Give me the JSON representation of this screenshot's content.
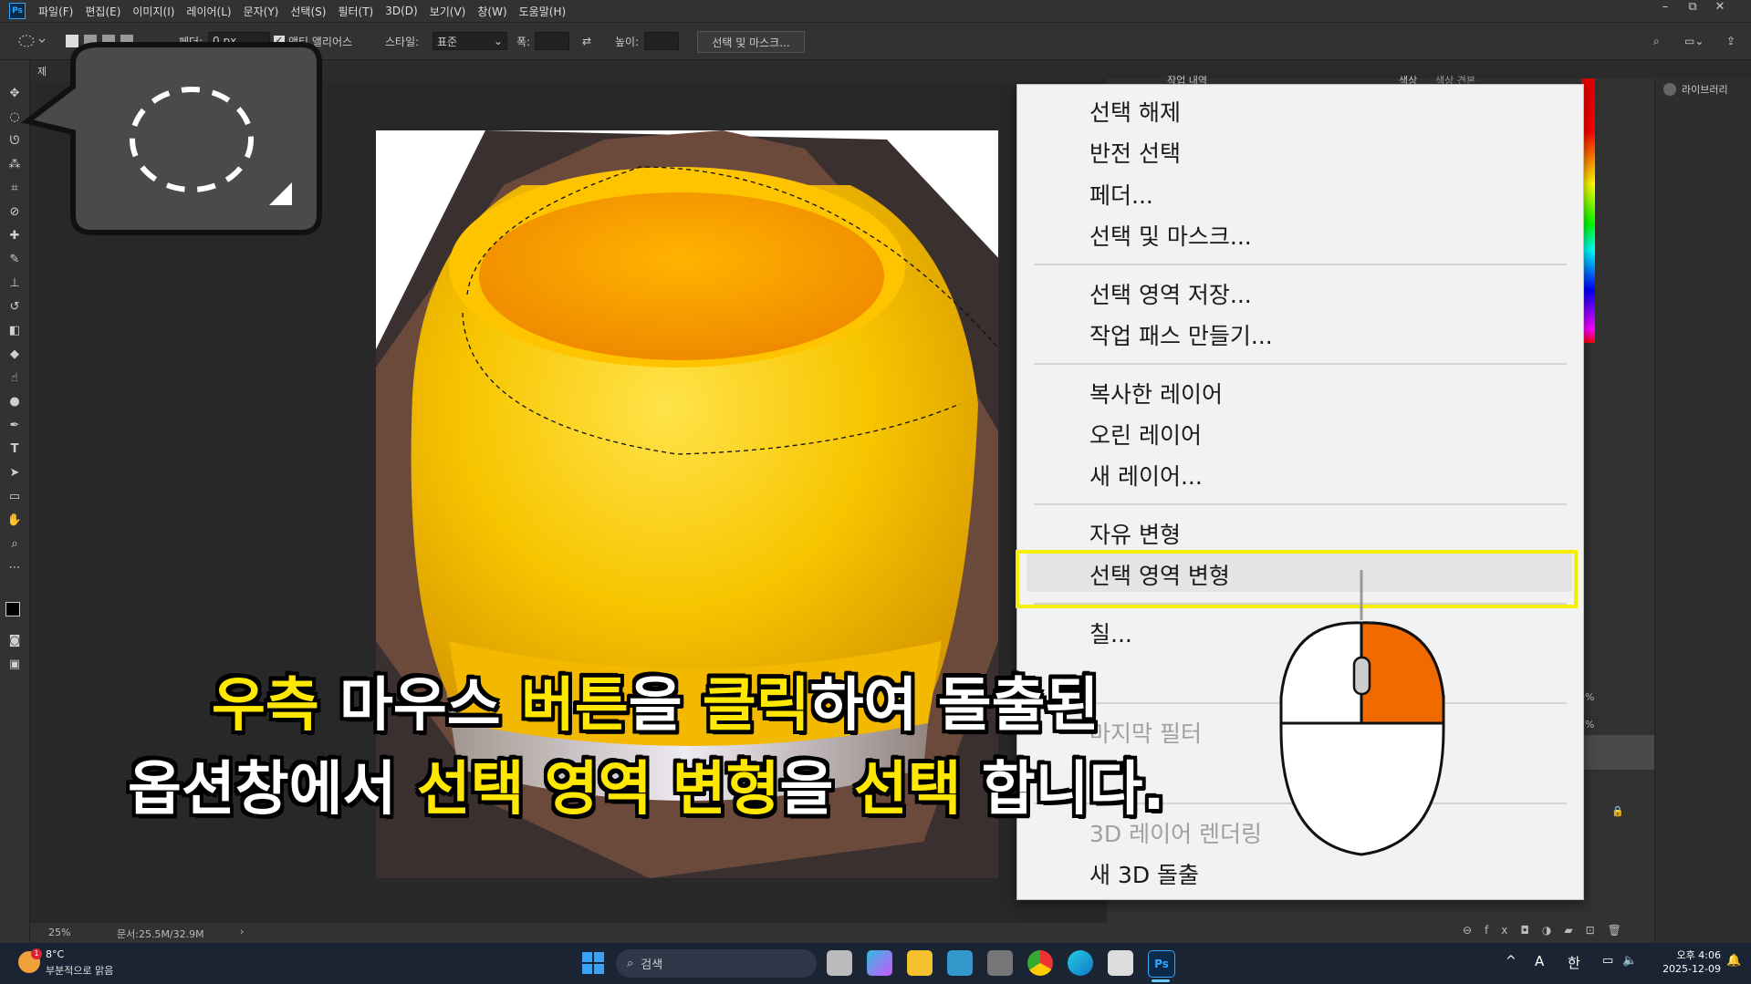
{
  "app": {
    "logo": "Ps"
  },
  "menubar": {
    "items": [
      "파일(F)",
      "편집(E)",
      "이미지(I)",
      "레이어(L)",
      "문자(Y)",
      "선택(S)",
      "필터(T)",
      "3D(D)",
      "보기(V)",
      "창(W)",
      "도움말(H)"
    ],
    "window_controls": [
      "–",
      "⧉",
      "✕"
    ]
  },
  "options": {
    "feather_label": "페더:",
    "feather_value": "0 px",
    "antialias_label": "앤티 앨리어스",
    "antialias_checked": true,
    "style_label": "스타일:",
    "style_value": "표준",
    "width_label": "폭:",
    "height_label": "높이:",
    "select_mask_button": "선택 및 마스크..."
  },
  "document": {
    "tab_label": "제"
  },
  "statusbar": {
    "zoom": "25%",
    "doc_info": "문서:25.5M/32.9M",
    "arrow": "›"
  },
  "panels": {
    "history_tab": "작업 내역",
    "color_tab": "색상",
    "swatches_tab": "색상 견본",
    "libraries": "라이브러리",
    "opacity_1": "%",
    "opacity_2": "%"
  },
  "context_menu": {
    "groups": [
      {
        "items": [
          {
            "label": "선택 해제",
            "disabled": false
          },
          {
            "label": "반전 선택",
            "disabled": false
          },
          {
            "label": "페더...",
            "disabled": false
          },
          {
            "label": "선택 및 마스크...",
            "disabled": false
          }
        ]
      },
      {
        "items": [
          {
            "label": "선택 영역 저장...",
            "disabled": false
          },
          {
            "label": "작업 패스 만들기...",
            "disabled": false
          }
        ]
      },
      {
        "items": [
          {
            "label": "복사한 레이어",
            "disabled": false
          },
          {
            "label": "오린 레이어",
            "disabled": false
          },
          {
            "label": "새 레이어...",
            "disabled": false
          }
        ]
      },
      {
        "items": [
          {
            "label": "자유 변형",
            "disabled": false
          },
          {
            "label": "선택 영역 변형",
            "disabled": false,
            "highlighted": true
          }
        ]
      },
      {
        "items": [
          {
            "label": "칠...",
            "disabled": false
          }
        ]
      },
      {
        "items": [
          {
            "label": "마지막 필터",
            "disabled": true
          }
        ]
      },
      {
        "items": [
          {
            "label": "3D 레이어 렌더링",
            "disabled": true
          },
          {
            "label": "새 3D 돌출",
            "disabled": false
          }
        ]
      }
    ]
  },
  "subtitle": {
    "line1": [
      {
        "text": "우측",
        "highlight": true
      },
      {
        "text": " 마우스 ",
        "highlight": false
      },
      {
        "text": "버튼",
        "highlight": true
      },
      {
        "text": "을 ",
        "highlight": false
      },
      {
        "text": "클릭",
        "highlight": true
      },
      {
        "text": "하여 돌출된",
        "highlight": false
      }
    ],
    "line2": [
      {
        "text": "옵션창에서 ",
        "highlight": false
      },
      {
        "text": "선택 영역 변형",
        "highlight": true
      },
      {
        "text": "을 ",
        "highlight": false
      },
      {
        "text": "선택",
        "highlight": true
      },
      {
        "text": " 합니다.",
        "highlight": false
      }
    ]
  },
  "taskbar": {
    "weather_temp": "8°C",
    "weather_desc": "부분적으로 맑음",
    "weather_badge": "1",
    "search_placeholder": "검색",
    "time": "오후 4:06",
    "date": "2025-12-09",
    "ime_a": "A",
    "ime_han": "한",
    "tray_up": "^"
  },
  "colors": {
    "highlight_yellow": "#ffe800",
    "mouse_orange": "#f06a00",
    "ps_blue": "#31a8ff"
  }
}
